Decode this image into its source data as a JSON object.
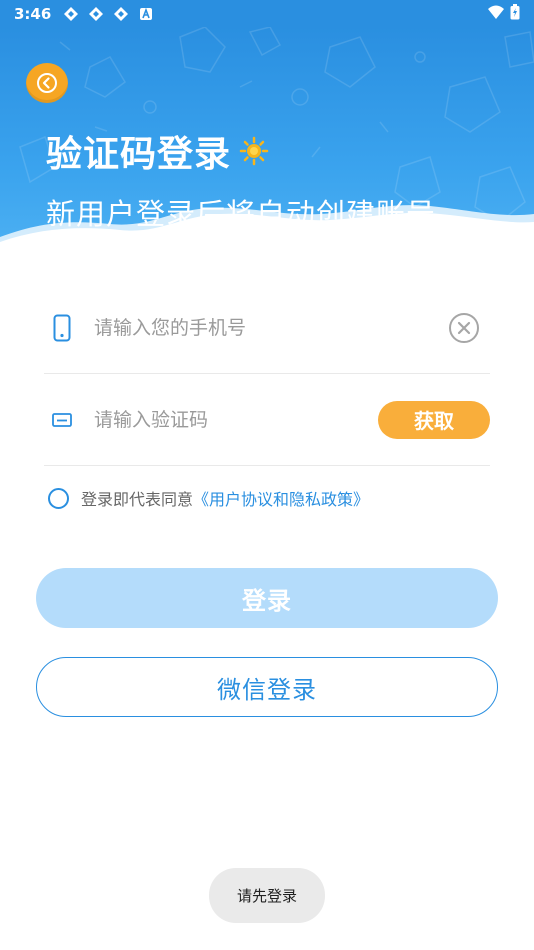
{
  "status_bar": {
    "time": "3:46",
    "notification_icons": [
      "sync-icon",
      "sync-icon",
      "sync-icon",
      "a-icon"
    ],
    "right_icons": [
      "wifi-icon",
      "battery-icon"
    ]
  },
  "header": {
    "title": "验证码登录",
    "subtitle": "新用户登录后将自动创建账号",
    "back_icon": "chevron-left-icon",
    "title_icon": "sun-icon"
  },
  "phone_field": {
    "placeholder": "请输入您的手机号",
    "value": "",
    "icon": "phone-icon",
    "clear_icon": "clear-icon"
  },
  "code_field": {
    "placeholder": "请输入验证码",
    "value": "",
    "icon": "sms-icon",
    "get_code_label": "获取"
  },
  "agreement": {
    "prefix": "登录即代表同意",
    "link": "《用户协议和隐私政策》",
    "checked": false
  },
  "login_button": {
    "label": "登录"
  },
  "wechat_button": {
    "label": "微信登录"
  },
  "toast": {
    "text": "请先登录"
  },
  "colors": {
    "primary": "#2a8fe0",
    "accent": "#f9ae3b",
    "login_disabled": "#b4dcfb",
    "toast_bg": "#eaeaea"
  }
}
